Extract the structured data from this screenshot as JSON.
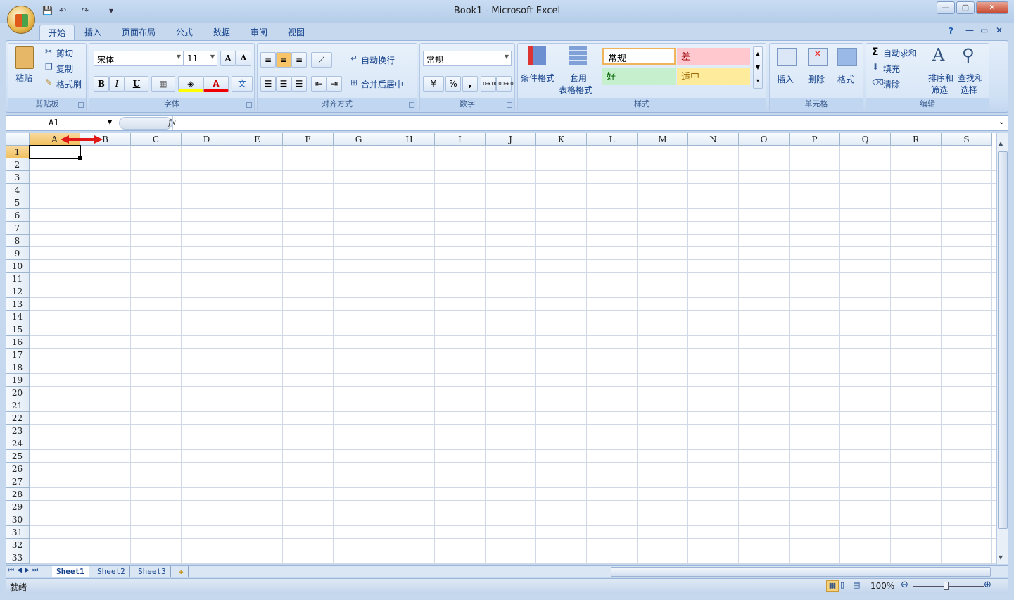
{
  "window": {
    "title": "Book1 - Microsoft Excel",
    "minimize": "—",
    "maximize": "▢",
    "close": "✕"
  },
  "qat": {
    "save": "💾",
    "undo": "↶",
    "redo": "↷",
    "customize": "▾"
  },
  "tabs": [
    "开始",
    "插入",
    "页面布局",
    "公式",
    "数据",
    "审阅",
    "视图"
  ],
  "ribbon_right": {
    "help": "?",
    "min": "—",
    "restore": "▭",
    "close": "✕"
  },
  "clipboard": {
    "paste": "粘贴",
    "cut": "剪切",
    "copy": "复制",
    "format_painter": "格式刷",
    "label": "剪贴板"
  },
  "font": {
    "name": "宋体",
    "size": "11",
    "grow": "A",
    "shrink": "A",
    "bold": "B",
    "italic": "I",
    "underline": "U",
    "border": "▦",
    "fill": "◈",
    "color": "A",
    "phonetic": "文",
    "label": "字体"
  },
  "alignment": {
    "wrap": "自动换行",
    "merge": "合并后居中",
    "label": "对齐方式"
  },
  "number": {
    "format": "常规",
    "currency": "¥",
    "percent": "%",
    "comma": ",",
    "inc": ".0→.00",
    "dec": ".00→.0",
    "label": "数字"
  },
  "styles": {
    "conditional": "条件格式",
    "table_1": "套用",
    "table_2": "表格格式",
    "normal": "常规",
    "bad": "差",
    "good": "好",
    "neutral": "适中",
    "label": "样式",
    "bad_color": "#ffc7ce",
    "good_color": "#c6efce",
    "neutral_color": "#ffeb9c"
  },
  "cells": {
    "insert": "插入",
    "delete": "删除",
    "format": "格式",
    "label": "单元格"
  },
  "editing": {
    "autosum": "自动求和",
    "fill": "填充",
    "clear": "清除",
    "sort_1": "排序和",
    "sort_2": "筛选",
    "find_1": "查找和",
    "find_2": "选择",
    "label": "编辑"
  },
  "formula_bar": {
    "name_box": "A1",
    "fx": "fx",
    "formula": ""
  },
  "grid": {
    "columns": [
      "A",
      "B",
      "C",
      "D",
      "E",
      "F",
      "G",
      "H",
      "I",
      "J",
      "K",
      "L",
      "M",
      "N",
      "O",
      "P",
      "Q",
      "R",
      "S"
    ],
    "rows": 33,
    "active_cell": "A1"
  },
  "sheets": [
    "Sheet1",
    "Sheet2",
    "Sheet3"
  ],
  "status": {
    "text": "就绪",
    "zoom": "100%"
  }
}
